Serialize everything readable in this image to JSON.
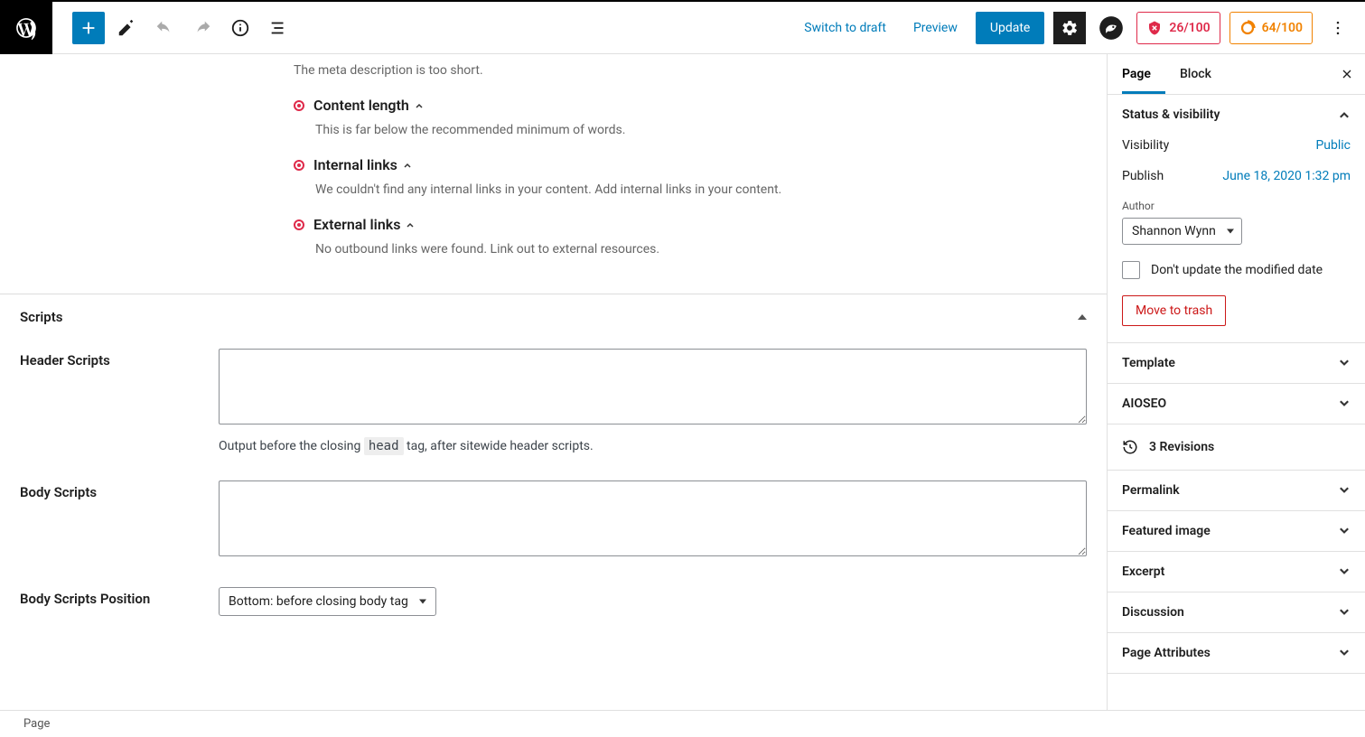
{
  "toolbar": {
    "switch_draft": "Switch to draft",
    "preview": "Preview",
    "update": "Update"
  },
  "scores": {
    "seo": "26/100",
    "readability": "64/100"
  },
  "seo_items": [
    {
      "title": "",
      "desc": "The meta description is too short."
    },
    {
      "title": "Content length",
      "desc": "This is far below the recommended minimum of words."
    },
    {
      "title": "Internal links",
      "desc": "We couldn't find any internal links in your content. Add internal links in your content."
    },
    {
      "title": "External links",
      "desc": "No outbound links were found. Link out to external resources."
    }
  ],
  "scripts": {
    "panel_title": "Scripts",
    "header_label": "Header Scripts",
    "header_hint_pre": "Output before the closing ",
    "header_hint_code": "head",
    "header_hint_post": " tag, after sitewide header scripts.",
    "body_label": "Body Scripts",
    "position_label": "Body Scripts Position",
    "position_value": "Bottom: before closing body tag"
  },
  "sidebar": {
    "tab_page": "Page",
    "tab_block": "Block",
    "status_title": "Status & visibility",
    "visibility_label": "Visibility",
    "visibility_value": "Public",
    "publish_label": "Publish",
    "publish_value": "June 18, 2020 1:32 pm",
    "author_label": "Author",
    "author_value": "Shannon Wynn",
    "dont_update": "Don't update the modified date",
    "trash": "Move to trash",
    "panels": {
      "template": "Template",
      "aioseo": "AIOSEO",
      "revisions": "3 Revisions",
      "permalink": "Permalink",
      "featured": "Featured image",
      "excerpt": "Excerpt",
      "discussion": "Discussion",
      "attributes": "Page Attributes"
    }
  },
  "footer": {
    "breadcrumb": "Page"
  }
}
